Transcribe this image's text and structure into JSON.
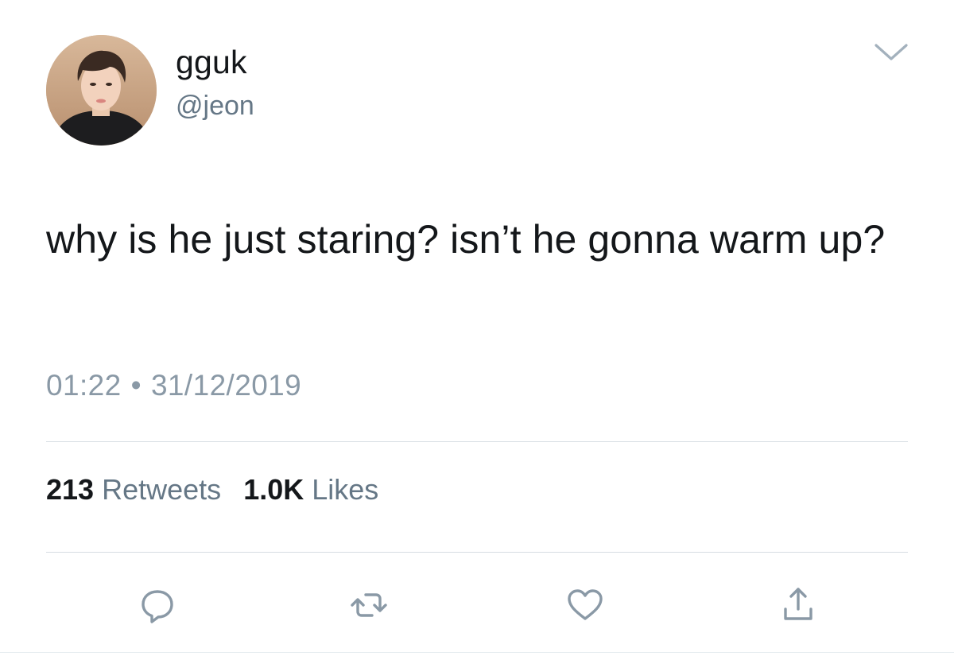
{
  "tweet": {
    "user": {
      "display_name": "gguk",
      "handle": "@jeon",
      "avatar_icon": "profile-photo"
    },
    "text": "why is he just staring? isn’t he gonna warm up?",
    "time": "01:22",
    "separator": "•",
    "date": "31/12/2019",
    "stats": {
      "retweets_count": "213",
      "retweets_label": "Retweets",
      "likes_count": "1.0K",
      "likes_label": "Likes"
    },
    "actions": {
      "reply_icon": "comment-bubble-icon",
      "retweet_icon": "retweet-icon",
      "like_icon": "heart-icon",
      "share_icon": "share-icon"
    }
  },
  "colors": {
    "text_primary": "#14171a",
    "text_secondary": "#657786",
    "icon_gray": "#8a99a6",
    "divider": "#d6dde3"
  }
}
